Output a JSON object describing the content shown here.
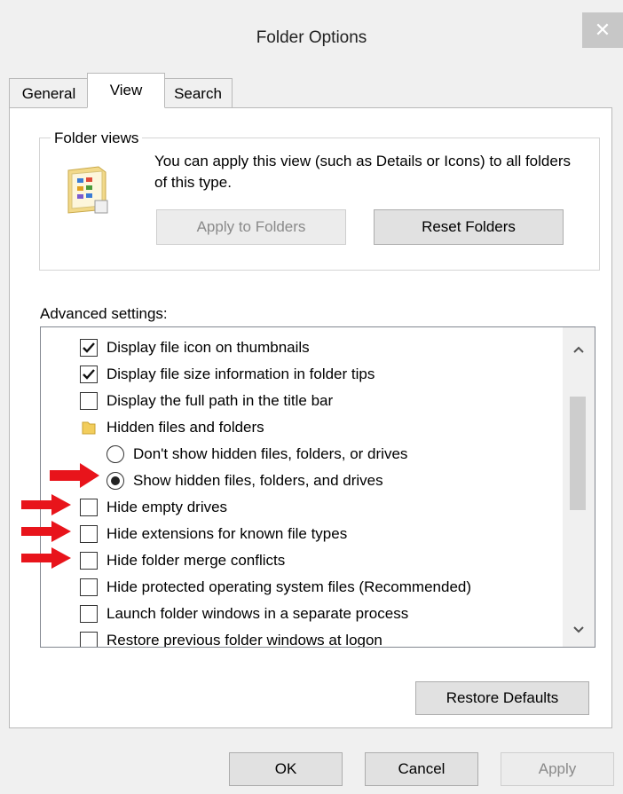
{
  "window": {
    "title": "Folder Options",
    "close_glyph": "✕"
  },
  "tabs": [
    {
      "label": "General",
      "active": false
    },
    {
      "label": "View",
      "active": true
    },
    {
      "label": "Search",
      "active": false
    }
  ],
  "folder_views": {
    "group_label": "Folder views",
    "description": "You can apply this view (such as Details or Icons) to all folders of this type.",
    "apply_label": "Apply to Folders",
    "reset_label": "Reset Folders",
    "icon": "folder-view-icon"
  },
  "advanced": {
    "label": "Advanced settings:",
    "items": [
      {
        "type": "checkbox",
        "checked": true,
        "label": "Display file icon on thumbnails"
      },
      {
        "type": "checkbox",
        "checked": true,
        "label": "Display file size information in folder tips"
      },
      {
        "type": "checkbox",
        "checked": false,
        "label": "Display the full path in the title bar"
      },
      {
        "type": "folder",
        "label": "Hidden files and folders"
      },
      {
        "type": "radio",
        "checked": false,
        "label": "Don't show hidden files, folders, or drives"
      },
      {
        "type": "radio",
        "checked": true,
        "label": "Show hidden files, folders, and drives"
      },
      {
        "type": "checkbox",
        "checked": false,
        "label": "Hide empty drives"
      },
      {
        "type": "checkbox",
        "checked": false,
        "label": "Hide extensions for known file types"
      },
      {
        "type": "checkbox",
        "checked": false,
        "label": "Hide folder merge conflicts"
      },
      {
        "type": "checkbox",
        "checked": false,
        "label": "Hide protected operating system files (Recommended)"
      },
      {
        "type": "checkbox",
        "checked": false,
        "label": "Launch folder windows in a separate process"
      },
      {
        "type": "checkbox",
        "checked": false,
        "label": "Restore previous folder windows at logon"
      }
    ]
  },
  "buttons": {
    "restore_defaults": "Restore Defaults",
    "ok": "OK",
    "cancel": "Cancel",
    "apply": "Apply"
  },
  "colors": {
    "annotation_arrow": "#e8141b",
    "accent_gray": "#c7c7c7"
  }
}
